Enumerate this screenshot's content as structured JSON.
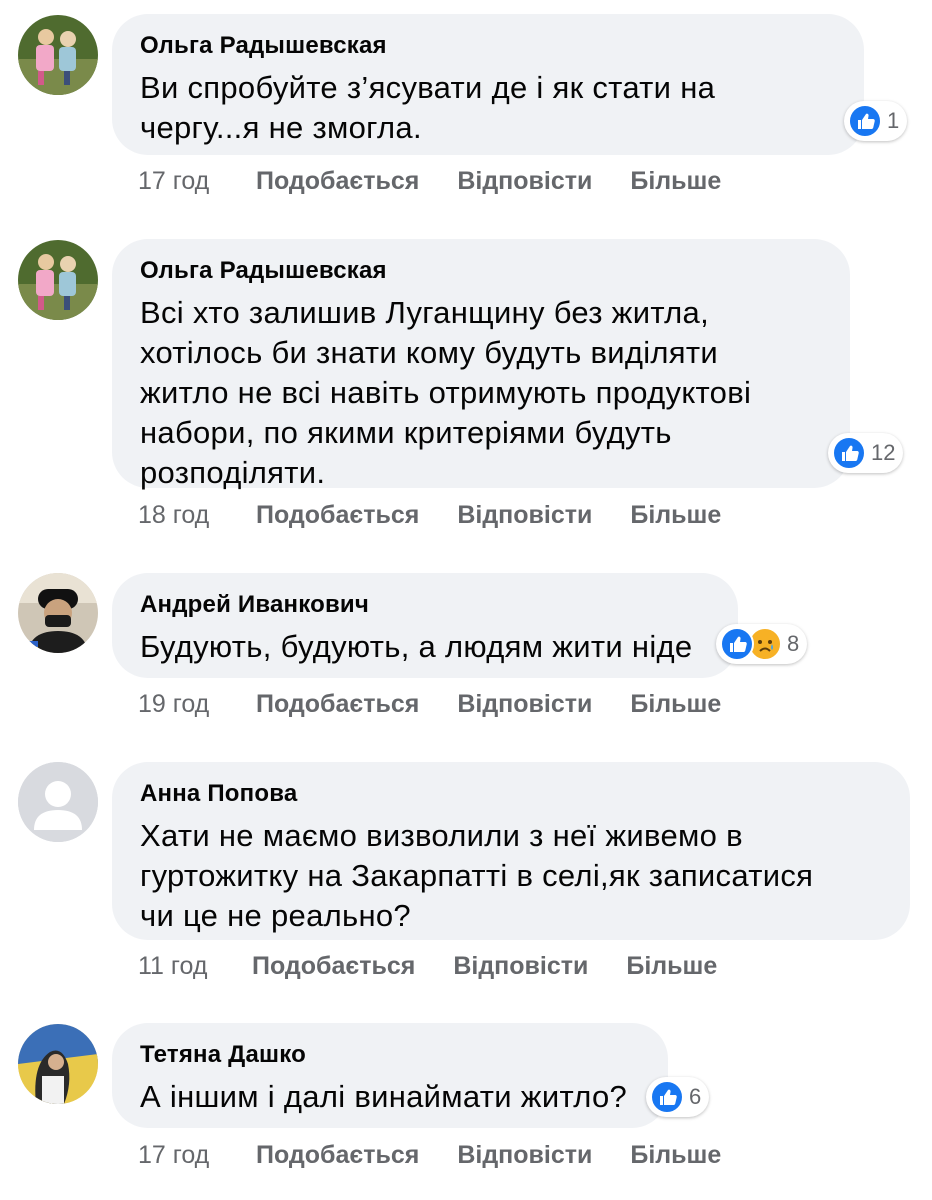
{
  "comments": [
    {
      "author": "Ольга Радышевская",
      "lines": [
        "Ви спробуйте з’ясувати де і як стати на",
        "чергу...я не змогла."
      ],
      "reactions": {
        "count": "1",
        "types": [
          "like"
        ]
      },
      "time": "17 год",
      "like_label": "Подобається",
      "reply_label": "Відповісти",
      "more_label": "Більше"
    },
    {
      "author": "Ольга Радышевская",
      "lines": [
        "Всі хто залишив Луганщину без житла,",
        "хотілось би знати кому будуть виділяти",
        "житло не всі навіть отримують продуктові",
        "набори, по якими критеріями будуть",
        "розподіляти."
      ],
      "reactions": {
        "count": "12",
        "types": [
          "like"
        ]
      },
      "time": "18 год",
      "like_label": "Подобається",
      "reply_label": "Відповісти",
      "more_label": "Більше"
    },
    {
      "author": "Андрей Иванкович",
      "lines": [
        "Будують, будують, а людям жити ніде"
      ],
      "reactions": {
        "count": "8",
        "types": [
          "like",
          "sad"
        ]
      },
      "time": "19 год",
      "like_label": "Подобається",
      "reply_label": "Відповісти",
      "more_label": "Більше"
    },
    {
      "author": "Анна Попова",
      "lines": [
        "Хати не маємо визволили з неї живемо в",
        "гуртожитку на Закарпатті в селі,як записатися",
        "чи це не реально?"
      ],
      "reactions": null,
      "time": "11 год",
      "like_label": "Подобається",
      "reply_label": "Відповісти",
      "more_label": "Більше"
    },
    {
      "author": "Тетяна Дашко",
      "lines": [
        "А іншим і далі винаймати житло?"
      ],
      "reactions": {
        "count": "6",
        "types": [
          "like"
        ]
      },
      "time": "17 год",
      "like_label": "Подобається",
      "reply_label": "Відповісти",
      "more_label": "Більше"
    }
  ],
  "colors": {
    "bubble": "#f0f2f5",
    "like": "#1877f2",
    "sad": "#f7b125",
    "meta": "#65676b"
  }
}
